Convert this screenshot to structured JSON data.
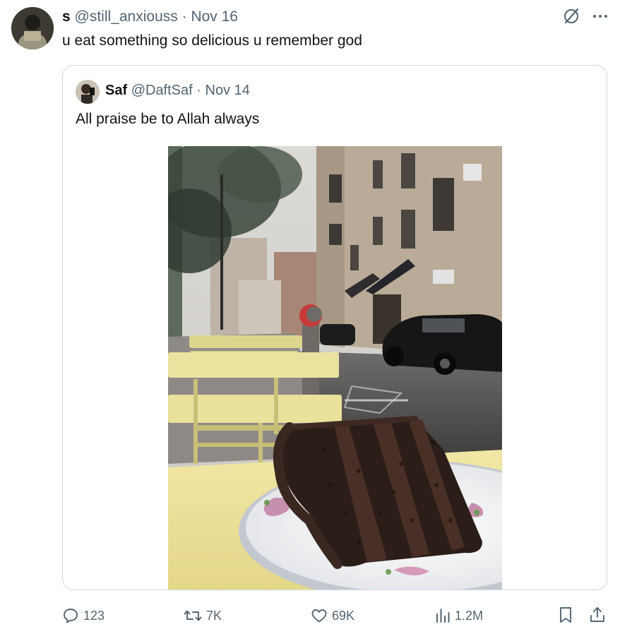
{
  "post": {
    "display_name": "s",
    "handle": "@still_anxiouss",
    "separator": "·",
    "date": "Nov 16",
    "text": "u eat something so delicious u remember god"
  },
  "top_icons": [
    "grok-icon",
    "more-icon"
  ],
  "quoted": {
    "display_name": "Saf",
    "handle": "@DaftSaf",
    "separator": "·",
    "date": "Nov 14",
    "text": "All praise be to Allah always"
  },
  "actions": {
    "replies": "123",
    "reposts": "7K",
    "likes": "69K",
    "views": "1.2M"
  },
  "colors": {
    "muted": "#536471",
    "border": "#cfd9de",
    "text": "#0f1419"
  }
}
